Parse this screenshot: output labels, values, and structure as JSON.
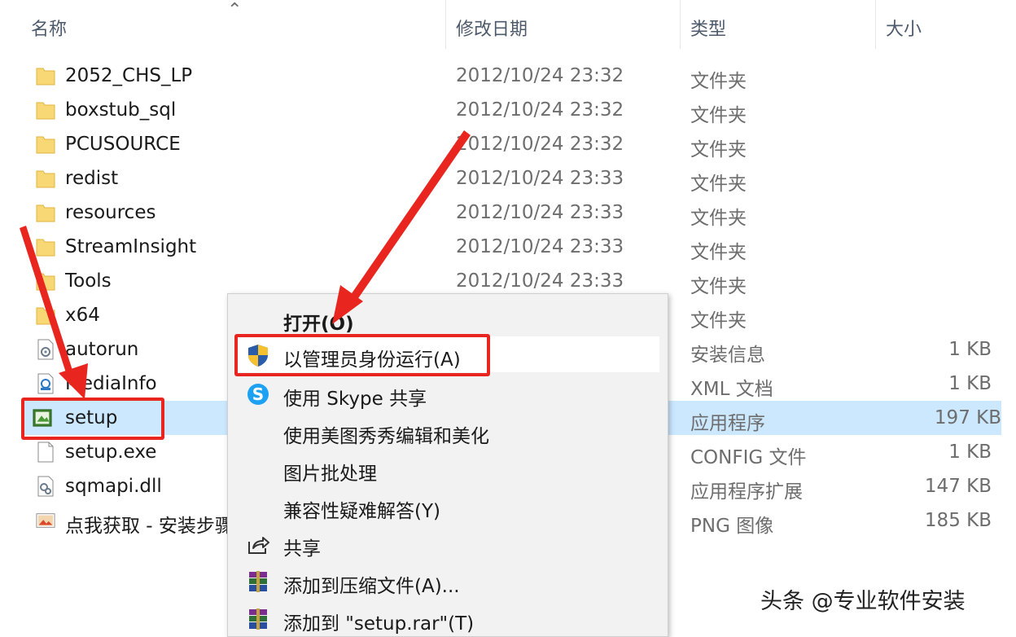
{
  "columns": {
    "name": "名称",
    "date": "修改日期",
    "type": "类型",
    "size": "大小"
  },
  "files": [
    {
      "name": "2052_CHS_LP",
      "date": "2012/10/24 23:32",
      "type": "文件夹",
      "size": "",
      "icon": "folder-icon"
    },
    {
      "name": "boxstub_sql",
      "date": "2012/10/24 23:32",
      "type": "文件夹",
      "size": "",
      "icon": "folder-icon"
    },
    {
      "name": "PCUSOURCE",
      "date": "2012/10/24 23:32",
      "type": "文件夹",
      "size": "",
      "icon": "folder-icon"
    },
    {
      "name": "redist",
      "date": "2012/10/24 23:33",
      "type": "文件夹",
      "size": "",
      "icon": "folder-icon"
    },
    {
      "name": "resources",
      "date": "2012/10/24 23:33",
      "type": "文件夹",
      "size": "",
      "icon": "folder-icon"
    },
    {
      "name": "StreamInsight",
      "date": "2012/10/24 23:33",
      "type": "文件夹",
      "size": "",
      "icon": "folder-icon"
    },
    {
      "name": "Tools",
      "date": "2012/10/24 23:33",
      "type": "文件夹",
      "size": "",
      "icon": "folder-icon"
    },
    {
      "name": "x64",
      "date": "",
      "type": "文件夹",
      "size": "",
      "icon": "folder-icon"
    },
    {
      "name": "autorun",
      "date": "",
      "type": "安装信息",
      "size": "1 KB",
      "icon": "settings-file-icon"
    },
    {
      "name": "MediaInfo",
      "date": "",
      "type": "XML 文档",
      "size": "1 KB",
      "icon": "xml-file-icon"
    },
    {
      "name": "setup",
      "date": "",
      "type": "应用程序",
      "size": "197 KB",
      "icon": "setup-app-icon"
    },
    {
      "name": "setup.exe",
      "date": "",
      "type": "CONFIG 文件",
      "size": "1 KB",
      "icon": "blank-file-icon"
    },
    {
      "name": "sqmapi.dll",
      "date": "",
      "type": "应用程序扩展",
      "size": "147 KB",
      "icon": "dll-file-icon"
    },
    {
      "name": "点我获取 - 安装步骤",
      "date": "",
      "type": "PNG 图像",
      "size": "185 KB",
      "icon": "image-file-icon"
    }
  ],
  "context_menu": [
    {
      "label": "打开(O)",
      "icon": "",
      "bold": true
    },
    {
      "label": "以管理员身份运行(A)",
      "icon": "uac-shield-icon"
    },
    {
      "label": "使用 Skype 共享",
      "icon": "skype-icon"
    },
    {
      "label": "使用美图秀秀编辑和美化",
      "icon": ""
    },
    {
      "label": "图片批处理",
      "icon": ""
    },
    {
      "label": "兼容性疑难解答(Y)",
      "icon": ""
    },
    {
      "label": "共享",
      "icon": "share-icon"
    },
    {
      "label": "添加到压缩文件(A)...",
      "icon": "winrar-icon"
    },
    {
      "label": "添加到 \"setup.rar\"(T)",
      "icon": "winrar-icon"
    }
  ],
  "watermark": "头条 @专业软件安装",
  "colors": {
    "selection": "#cce8ff",
    "annotation_red": "#e8261f",
    "menu_bg": "#f2f2f2"
  }
}
